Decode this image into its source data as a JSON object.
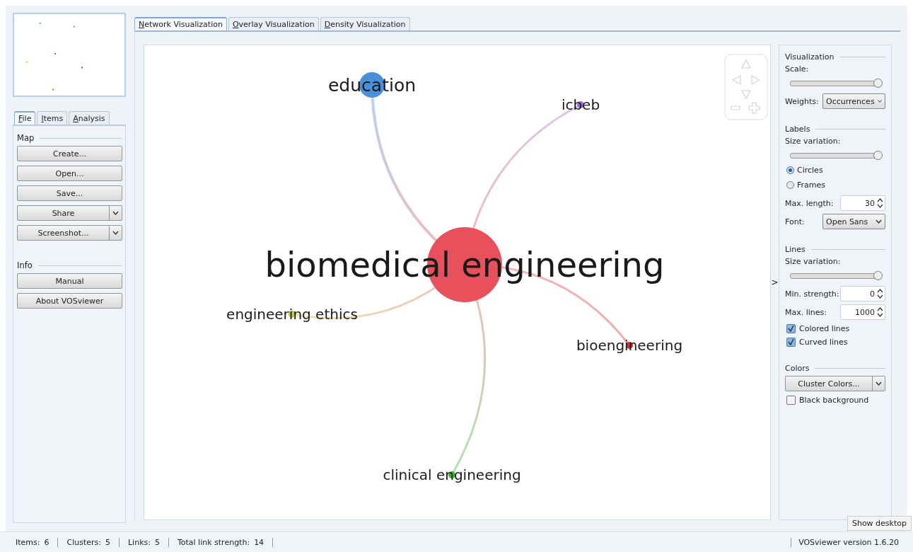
{
  "left_panel": {
    "tabs": [
      {
        "label": "File",
        "selected": true
      },
      {
        "label": "Items",
        "selected": false
      },
      {
        "label": "Analysis",
        "selected": false
      }
    ],
    "sections": [
      {
        "title": "Map",
        "buttons": [
          {
            "label": "Create...",
            "kind": "plain"
          },
          {
            "label": "Open...",
            "kind": "plain"
          },
          {
            "label": "Save...",
            "kind": "plain"
          },
          {
            "label": "Share",
            "kind": "split"
          },
          {
            "label": "Screenshot...",
            "kind": "split"
          }
        ]
      },
      {
        "title": "Info",
        "buttons": [
          {
            "label": "Manual",
            "kind": "plain"
          },
          {
            "label": "About VOSviewer",
            "kind": "plain"
          }
        ]
      }
    ]
  },
  "view_tabs": [
    {
      "label": "Network Visualization",
      "selected": true
    },
    {
      "label": "Overlay Visualization",
      "selected": false
    },
    {
      "label": "Density Visualization",
      "selected": false
    }
  ],
  "network": {
    "nodes": [
      {
        "label": "biomedical engineering",
        "color": "#e8505b"
      },
      {
        "label": "education",
        "color": "#4a90d9"
      },
      {
        "label": "icbeb",
        "color": "#9b6fd0"
      },
      {
        "label": "engineering ethics",
        "color": "#c8c83a"
      },
      {
        "label": "bioengineering",
        "color": "#d62f2f"
      },
      {
        "label": "clinical engineering",
        "color": "#3cb43c"
      }
    ]
  },
  "collapse_arrow": ">",
  "right_panel": {
    "visualization": {
      "title": "Visualization",
      "scale": {
        "label": "Scale:",
        "level": 1
      },
      "weights": {
        "label": "Weights:",
        "value": "Occurrences"
      }
    },
    "labels": {
      "title": "Labels",
      "size_variation": {
        "label": "Size variation:",
        "level": 1
      },
      "shapes": [
        {
          "label": "Circles",
          "selected": true
        },
        {
          "label": "Frames",
          "selected": false
        }
      ],
      "max_length": {
        "label": "Max. length:",
        "value": "30"
      },
      "font": {
        "label": "Font:",
        "value": "Open Sans"
      }
    },
    "lines": {
      "title": "Lines",
      "size_variation": {
        "label": "Size variation:",
        "level": 1
      },
      "min_strength": {
        "label": "Min. strength:",
        "value": "0"
      },
      "max_lines": {
        "label": "Max. lines:",
        "value": "1000"
      },
      "options": [
        {
          "label": "Colored lines",
          "checked": true
        },
        {
          "label": "Curved lines",
          "checked": true
        }
      ]
    },
    "colors": {
      "title": "Colors",
      "button": "Cluster Colors...",
      "black_background": {
        "label": "Black background",
        "checked": false
      }
    }
  },
  "status_bar": {
    "items": [
      {
        "label": "Items:",
        "value": "6"
      },
      {
        "label": "Clusters:",
        "value": "5"
      },
      {
        "label": "Links:",
        "value": "5"
      },
      {
        "label": "Total link strength:",
        "value": "14"
      }
    ],
    "version": "VOSviewer version 1.6.20"
  },
  "tooltip": "Show desktop"
}
